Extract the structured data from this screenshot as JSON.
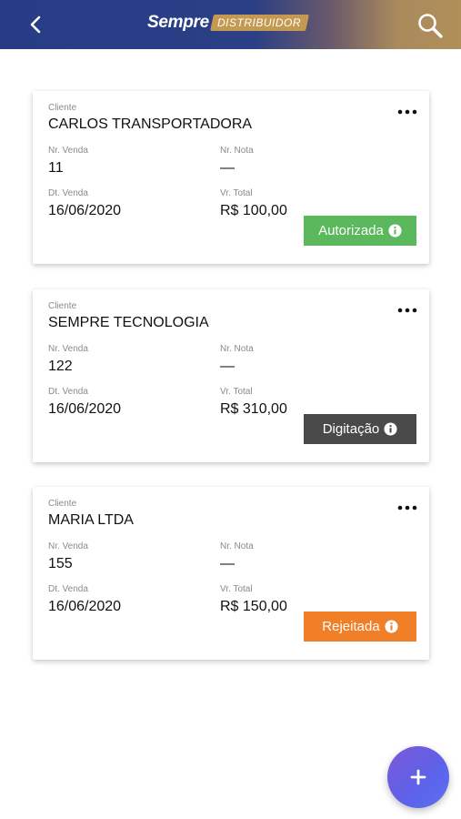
{
  "header": {
    "logo_main": "Sempre",
    "logo_tag": "DISTRIBUIDOR",
    "back_icon": "chevron-left-icon",
    "search_icon": "search-icon"
  },
  "labels": {
    "client": "Cliente",
    "sale_number": "Nr. Venda",
    "invoice_number": "Nr. Nota",
    "sale_date": "Dt. Venda",
    "total": "Vr. Total"
  },
  "orders": [
    {
      "client": "CARLOS TRANSPORTADORA",
      "sale_number": "11",
      "invoice_number": "—",
      "sale_date": "16/06/2020",
      "total": "R$ 100,00",
      "status": "Autorizada",
      "status_color": "#5cb85c"
    },
    {
      "client": "SEMPRE TECNOLOGIA",
      "sale_number": "122",
      "invoice_number": "—",
      "sale_date": "16/06/2020",
      "total": "R$ 310,00",
      "status": "Digitação",
      "status_color": "#4a4a4a"
    },
    {
      "client": "MARIA LTDA",
      "sale_number": "155",
      "invoice_number": "—",
      "sale_date": "16/06/2020",
      "total": "R$ 150,00",
      "status": "Rejeitada",
      "status_color": "#f07f27"
    }
  ],
  "fab": {
    "icon": "plus-icon"
  }
}
